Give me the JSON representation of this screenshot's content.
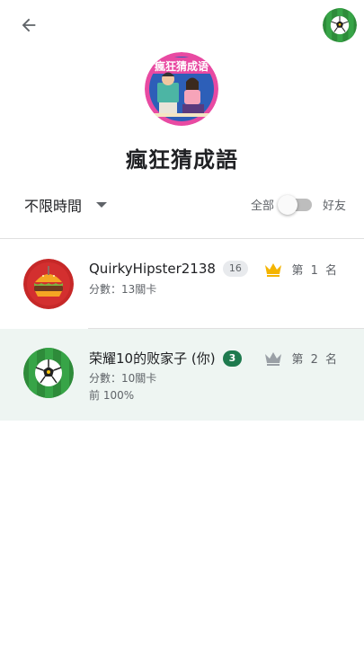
{
  "header": {
    "back_icon": "arrow-left-icon",
    "avatar_icon": "soccer-ball-avatar"
  },
  "game": {
    "title": "瘋狂猜成語",
    "logo_text": "瘋狂猜成语"
  },
  "filters": {
    "time_range": "不限時間",
    "toggle_left": "全部",
    "toggle_right": "好友"
  },
  "leaderboard": [
    {
      "name": "QuirkyHipster2138",
      "level": "16",
      "score": "分數：13關卡",
      "rank": "第 1 名",
      "crown_color": "#f4b400",
      "avatar_icon": "burger-avatar"
    },
    {
      "name": "荣耀10的败家子 (你)",
      "level": "3",
      "score": "分數：10關卡",
      "percentile": "前 100%",
      "rank": "第 2 名",
      "crown_color": "#9aa0a6",
      "avatar_icon": "soccer-ball-avatar"
    }
  ],
  "colors": {
    "highlight_row": "#eef5f2",
    "badge_green": "#1e7a4e",
    "gold": "#f4b400",
    "silver": "#9aa0a6"
  }
}
